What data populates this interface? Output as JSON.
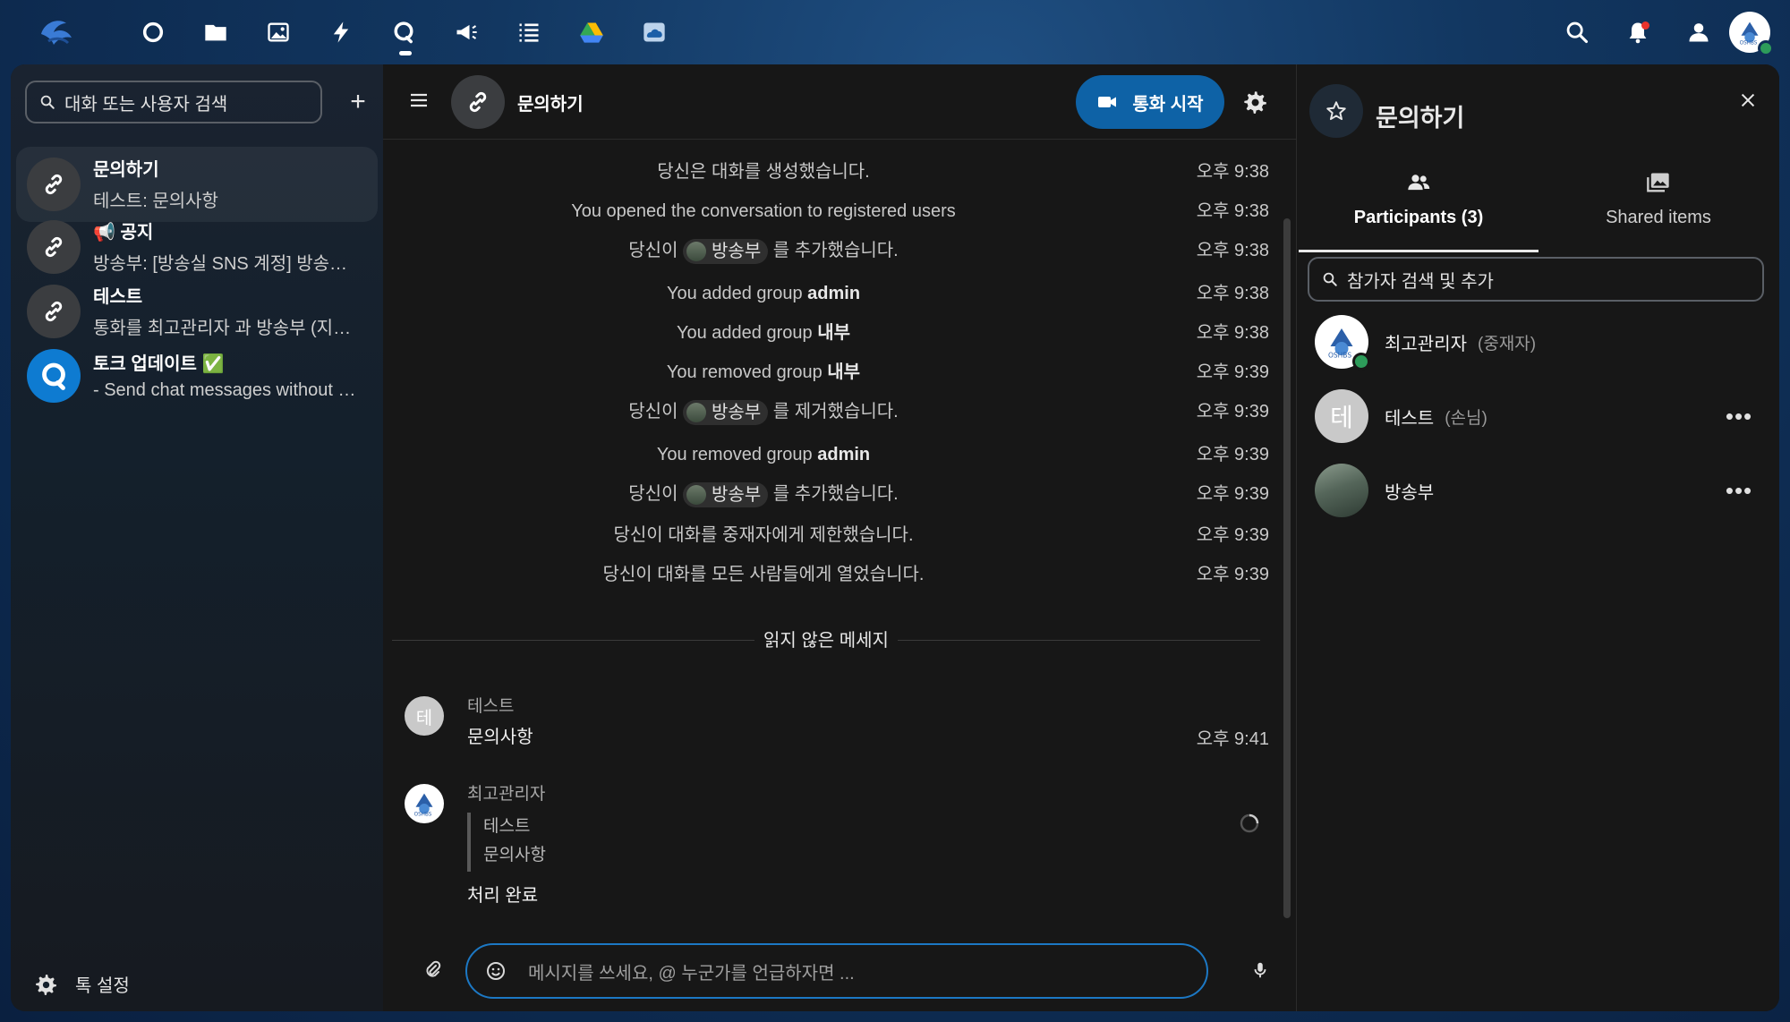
{
  "topbar": {
    "apps": [
      {
        "name": "dashboard-icon",
        "active": false
      },
      {
        "name": "files-icon",
        "active": false
      },
      {
        "name": "photos-icon",
        "active": false
      },
      {
        "name": "activity-icon",
        "active": false
      },
      {
        "name": "talk-icon",
        "active": true
      },
      {
        "name": "announcements-icon",
        "active": false
      },
      {
        "name": "tasks-icon",
        "active": false
      },
      {
        "name": "google-drive-icon",
        "active": false
      },
      {
        "name": "onedrive-icon",
        "active": false
      }
    ],
    "right_icons": [
      "search-icon",
      "notifications-icon",
      "contacts-icon"
    ]
  },
  "sidebar": {
    "search_placeholder": "대화 또는 사용자 검색",
    "conversations": [
      {
        "title": "문의하기",
        "preview": "테스트: 문의사항",
        "selected": true,
        "icon": "link-icon"
      },
      {
        "title": "📢 공지",
        "preview": "방송부: [방송실 SNS 계정] 방송실 SNS 계정 안내",
        "selected": false,
        "icon": "link-icon"
      },
      {
        "title": "테스트",
        "preview": "통화를 최고관리자 과 방송부 (지속 시간)",
        "selected": false,
        "icon": "link-icon"
      },
      {
        "title": "토크 업데이트 ✅",
        "preview": "- Send chat messages without notifying the recipients",
        "selected": false,
        "icon": "talk-logo-icon"
      }
    ],
    "settings_label": "톡 설정"
  },
  "chat": {
    "title": "문의하기",
    "call_button": "통화 시작",
    "system_messages": [
      {
        "text": "당신은 대화를 생성했습니다.",
        "time": "오후 9:38"
      },
      {
        "text": "You opened the conversation to registered users",
        "time": "오후 9:38"
      },
      {
        "pre": "당신이",
        "mention": "방송부",
        "post": "를 추가했습니다.",
        "time": "오후 9:38"
      },
      {
        "pre": "You added group",
        "bold": "admin",
        "time": "오후 9:38"
      },
      {
        "pre": "You added group",
        "bold": "내부",
        "time": "오후 9:38"
      },
      {
        "pre": "You removed group",
        "bold": "내부",
        "time": "오후 9:39"
      },
      {
        "pre": "당신이",
        "mention": "방송부",
        "post": "를 제거했습니다.",
        "time": "오후 9:39"
      },
      {
        "pre": "You removed group",
        "bold": "admin",
        "time": "오후 9:39"
      },
      {
        "pre": "당신이",
        "mention": "방송부",
        "post": "를 추가했습니다.",
        "time": "오후 9:39"
      },
      {
        "text": "당신이 대화를 중재자에게 제한했습니다.",
        "time": "오후 9:39"
      },
      {
        "text": "당신이 대화를 모든 사람들에게 열었습니다.",
        "time": "오후 9:39"
      }
    ],
    "unread_label": "읽지 않은 메세지",
    "messages": [
      {
        "author": "테스트",
        "avatar_letter": "테",
        "text": "문의사항",
        "time": "오후 9:41"
      },
      {
        "author": "최고관리자",
        "quote_author": "테스트",
        "quote_text": "문의사항",
        "text": "처리 완료",
        "pending": true
      }
    ],
    "composer_placeholder": "메시지를 쓰세요, @ 누군가를 언급하자면 ..."
  },
  "right_panel": {
    "title": "문의하기",
    "tabs": [
      {
        "label": "Participants (3)",
        "active": true
      },
      {
        "label": "Shared items",
        "active": false
      }
    ],
    "search_placeholder": "참가자 검색 및 추가",
    "participants": [
      {
        "name": "최고관리자",
        "role": "(중재자)",
        "online": true
      },
      {
        "name": "테스트",
        "role": "(손님)",
        "avatar_letter": "테"
      },
      {
        "name": "방송부",
        "role": ""
      }
    ]
  },
  "colors": {
    "accent": "#0e62a6",
    "online": "#2d9c5a",
    "background": "#171717"
  }
}
